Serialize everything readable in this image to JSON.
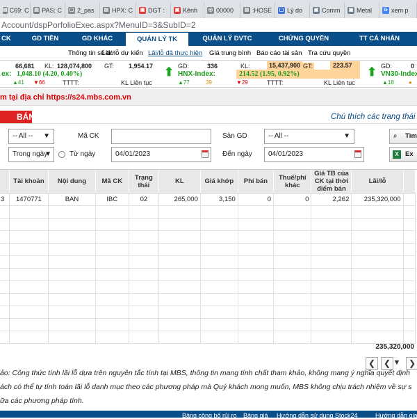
{
  "browser": {
    "tabs": [
      {
        "label": "C69: C",
        "icon": "page-icon",
        "color": "#7a7a7a"
      },
      {
        "label": "PAS: C",
        "icon": "page-icon",
        "color": "#7a7a7a"
      },
      {
        "label": "2_pas",
        "icon": "doc-icon",
        "color": "#888"
      },
      {
        "label": "HPX: C",
        "icon": "page-icon",
        "color": "#7a7a7a"
      },
      {
        "label": "DGT :",
        "icon": "tab-icon",
        "color": "#e03b3b"
      },
      {
        "label": "Kênh",
        "icon": "tab-icon",
        "color": "#e03b3b"
      },
      {
        "label": "00000",
        "icon": "globe-icon",
        "color": "#888"
      },
      {
        "label": ":HOSE",
        "icon": "page-icon",
        "color": "#7a7a7a"
      },
      {
        "label": "Lý do",
        "icon": "doc-icon",
        "color": "#3b6fd6"
      },
      {
        "label": "Comm",
        "icon": "tab-icon",
        "color": "#6e7b8c"
      },
      {
        "label": "Metal",
        "icon": "tab-icon",
        "color": "#6e7b8c"
      },
      {
        "label": "xem p",
        "icon": "google-icon",
        "color": "#4285f4"
      }
    ],
    "address": "Account/dspPorfolioExec.aspx?MenuID=3&SubID=2"
  },
  "nav": {
    "main": [
      "CK",
      "GD TIỀN",
      "GD KHÁC",
      "QUẢN LÝ TK",
      "QUẢN LÝ DVTC",
      "CHỨNG QUYỀN",
      "TT CÁ NHÂN"
    ],
    "sub": [
      "Thông tin số dư",
      "Lãi/ lỗ dự kiến",
      "Lãi/lỗ đã thực hiện",
      "Giá trung bình",
      "Báo cáo tài sản",
      "Tra cứu quyền"
    ]
  },
  "ticker": {
    "row1": {
      "a": "66,681",
      "kl_label": "KL:",
      "kl": "128,074,800",
      "gt_label": "GT:",
      "gt": "1,954.17",
      "gd_label": "GD:",
      "gd": "336",
      "kl2_label": "KL:",
      "kl2": "15,437,900",
      "gt2_label": "GT:",
      "gt2": "223.57",
      "gd3_label": "GD:",
      "gd3": "0"
    },
    "row2": {
      "idx1_label": "ex:",
      "idx1": "1,048.10 (4.20, 0.40%)",
      "idx2_label": "HNX-Index:",
      "idx2": "214.52 (1.95, 0.92%)",
      "idx3_label": "VN30-Index"
    },
    "row3": {
      "up1": "▲41",
      "down1": "▼66",
      "tttt": "TTTT:",
      "status1": "KL Liên tục",
      "up2": "▲77",
      "ref2": "39",
      "down2": "▼29",
      "tttt2": "TTTT:",
      "status2": "KL Liên tục",
      "up3": "▲18",
      "ref3": "●"
    }
  },
  "notice": "m tại địa chỉ https://s24.mbs.com.vn",
  "section": {
    "title": "BÁN",
    "legend": "Chú thích các trạng thái c"
  },
  "filters": {
    "all1": "-- All --",
    "stock_label": "Mã CK",
    "stock_value": "",
    "exchange_label": "Sàn GD",
    "exchange_value": "-- All --",
    "period": "Trong ngày",
    "from_label": "Từ ngày",
    "from_date": "04/01/2023",
    "to_label": "Đến ngày",
    "to_date": "04/01/2023",
    "search_btn": "Tìm k",
    "export_btn": "Ex"
  },
  "table": {
    "headers": [
      "",
      "Tài khoản",
      "Nội dung",
      "Mã CK",
      "Trạng thái",
      "KL",
      "Giá khớp",
      "Phí bán",
      "Thuế/phí khác",
      "Giá TB của CK tại thời điểm bán",
      "Lãi/lỗ"
    ],
    "rows": [
      [
        "3",
        "1470771",
        "BAN",
        "IBC",
        "02",
        "265,000",
        "3,150",
        "0",
        "0",
        "2,262",
        "235,320,000"
      ]
    ],
    "total": "235,320,000"
  },
  "footnote": {
    "l1": "ảo: Công thức tính lãi lỗ dựa trên nguyên tắc tính tại MBS, thông tin mang tính chất tham khảo, không mang ý nghĩa quyết định",
    "l2": "ách có thể tự tính toán lãi lỗ danh mục theo các phương pháp mà Quý khách mong muốn, MBS không chịu trách nhiệm về sự s",
    "l3": "ữa các phương pháp tính."
  },
  "footer": [
    "Bảng công bố rủi ro",
    "Bảng giá",
    "Hướng dẫn sử dụng Stock24",
    "Hướng dẫn gia"
  ]
}
